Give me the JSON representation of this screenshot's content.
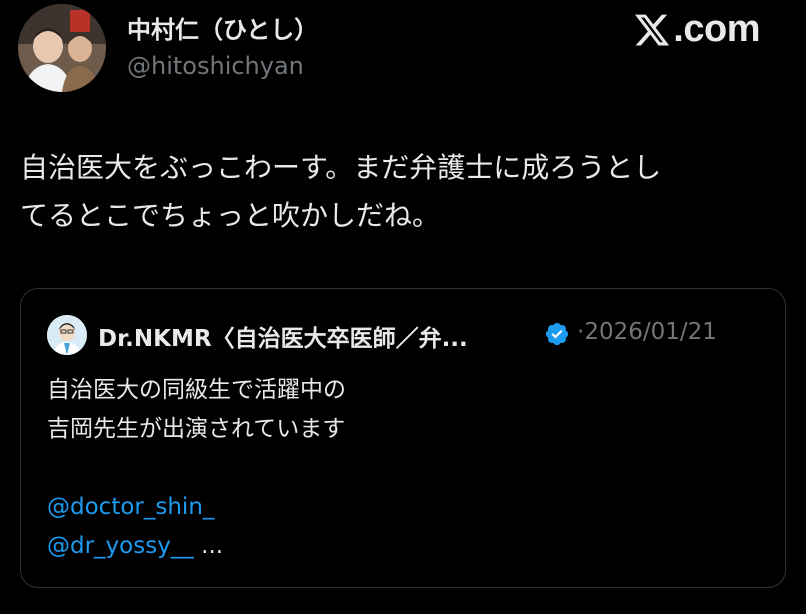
{
  "author": {
    "display_name": "中村仁（ひとし）",
    "handle": "@hitoshichyan"
  },
  "brand": {
    "text": ".com",
    "logo_icon": "x-logo-icon"
  },
  "tweet": {
    "lines": [
      "自治医大をぶっこわーす。まだ弁護士に成ろうとし",
      "てるとこでちょっと吹かしだね。"
    ]
  },
  "quoted_tweet": {
    "display_name": "Dr.NKMR〈自治医大卒医師／弁...",
    "separator": "·",
    "date": "2026/01/21",
    "text_lines": [
      "自治医大の同級生で活躍中の",
      "吉岡先生が出演されています"
    ],
    "mentions": [
      "@doctor_shin_",
      "@dr_yossy__"
    ],
    "truncation": "..."
  },
  "colors": {
    "background": "#000000",
    "text": "#e7e9ea",
    "secondary": "#71767b",
    "link": "#1d9bf0",
    "border": "#2f3336"
  }
}
